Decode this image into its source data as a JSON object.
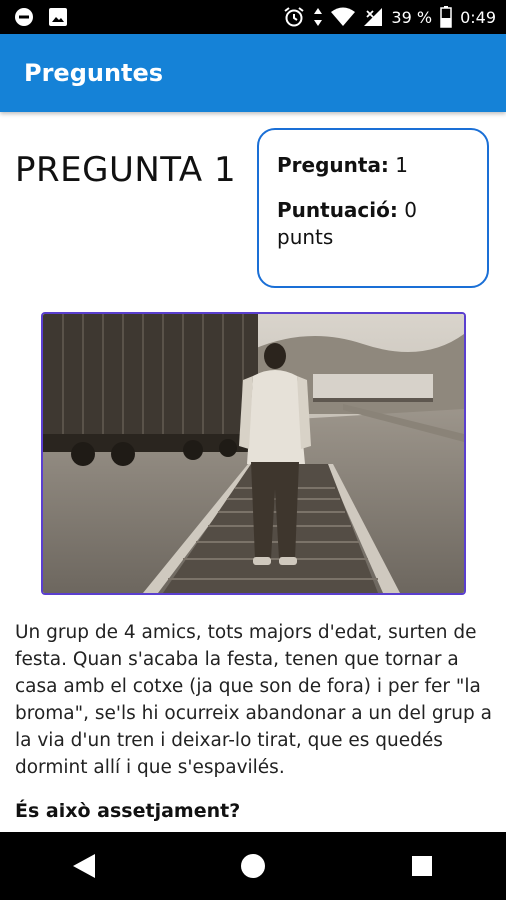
{
  "status_bar": {
    "battery_percent": "39 %",
    "time": "0:49",
    "icons": [
      "do-not-disturb-icon",
      "image-icon",
      "alarm-icon",
      "data-arrows-icon",
      "wifi-icon",
      "signal-icon",
      "battery-icon"
    ]
  },
  "app_bar": {
    "title": "Preguntes"
  },
  "question": {
    "heading": "PREGUNTA 1",
    "body": "Un grup de 4 amics, tots majors d'edat, surten de festa. Quan s'acaba la festa, tenen que tornar a casa amb el cotxe (ja que son de fora) i per fer \"la broma\", se'ls hi ocurreix abandonar a un del grup a la via d'un tren i deixar-lo tirat, que es quedés dormint allí i que s'espavilés.",
    "ask": "És això assetjament?"
  },
  "score_card": {
    "question_label": "Pregunta:",
    "question_value": "1",
    "score_label": "Puntuació:",
    "score_value": "0 punts"
  },
  "image": {
    "subject": "man-walking-on-railway-tracks"
  },
  "nav_bar": {
    "buttons": [
      "back-icon",
      "home-icon",
      "recents-icon"
    ]
  },
  "colors": {
    "app_bar": "#1582d7",
    "card_border": "#1a6fd6",
    "image_border": "#5a3fcf"
  }
}
